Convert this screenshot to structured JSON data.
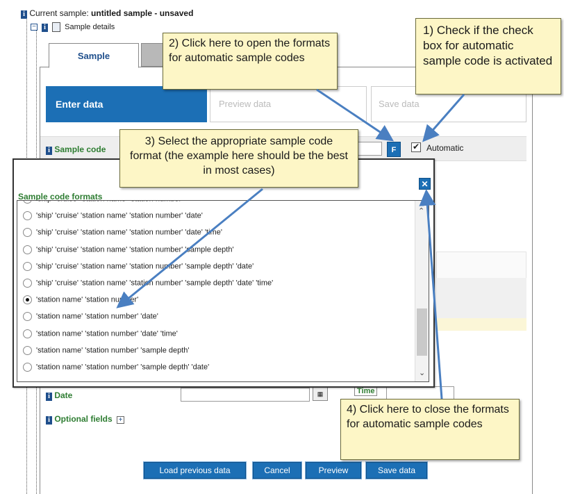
{
  "tree": {
    "current_sample_label": "Current sample: ",
    "current_sample_value": "untitled sample - unsaved",
    "sample_details_label": "Sample details"
  },
  "tabs": {
    "active_label": "Sample"
  },
  "steps": {
    "enter": "Enter data",
    "preview": "Preview data",
    "save": "Save data"
  },
  "sample_code": {
    "label": "Sample code",
    "format_button": "F",
    "automatic_label": "Automatic",
    "automatic_checked": true
  },
  "dialog": {
    "title": "Sample code formats",
    "close_symbol": "✕",
    "selected_index": 6,
    "options": [
      "'ship' 'cruise' 'station name' 'station number'",
      "'ship' 'cruise' 'station name' 'station number' 'date'",
      "'ship' 'cruise' 'station name' 'station number' 'date' 'time'",
      "'ship' 'cruise' 'station name' 'station number' 'sample depth'",
      "'ship' 'cruise' 'station name' 'station number' 'sample depth' 'date'",
      "'ship' 'cruise' 'station name' 'station number' 'sample depth' 'date' 'time'",
      "'station name' 'station number'",
      "'station name' 'station number' 'date'",
      "'station name' 'station number' 'date' 'time'",
      "'station name' 'station number' 'sample depth'",
      "'station name' 'station number' 'sample depth' 'date'"
    ]
  },
  "form": {
    "date_label": "Date",
    "time_label": "Time",
    "optional_label": "Optional fields"
  },
  "buttons": {
    "load": "Load previous data",
    "cancel": "Cancel",
    "preview": "Preview",
    "save": "Save data"
  },
  "callouts": {
    "c1": "1) Check if the check box for automatic sample code is activated",
    "c2": "2) Click here to open the formats for automatic sample codes",
    "c3": "3) Select the appropriate sample code format (the example here should be the best in most cases)",
    "c4": "4) Click here to close the formats for automatic sample codes"
  },
  "colors": {
    "accent": "#1c6fb5",
    "callout_bg": "#fdf6c6",
    "label_green": "#2e7d32",
    "arrow": "#4a7fc1"
  },
  "icons": {
    "info": "info-icon",
    "document": "document-icon",
    "calendar": "calendar-icon",
    "expand": "plus-icon",
    "collapse": "minus-icon"
  }
}
